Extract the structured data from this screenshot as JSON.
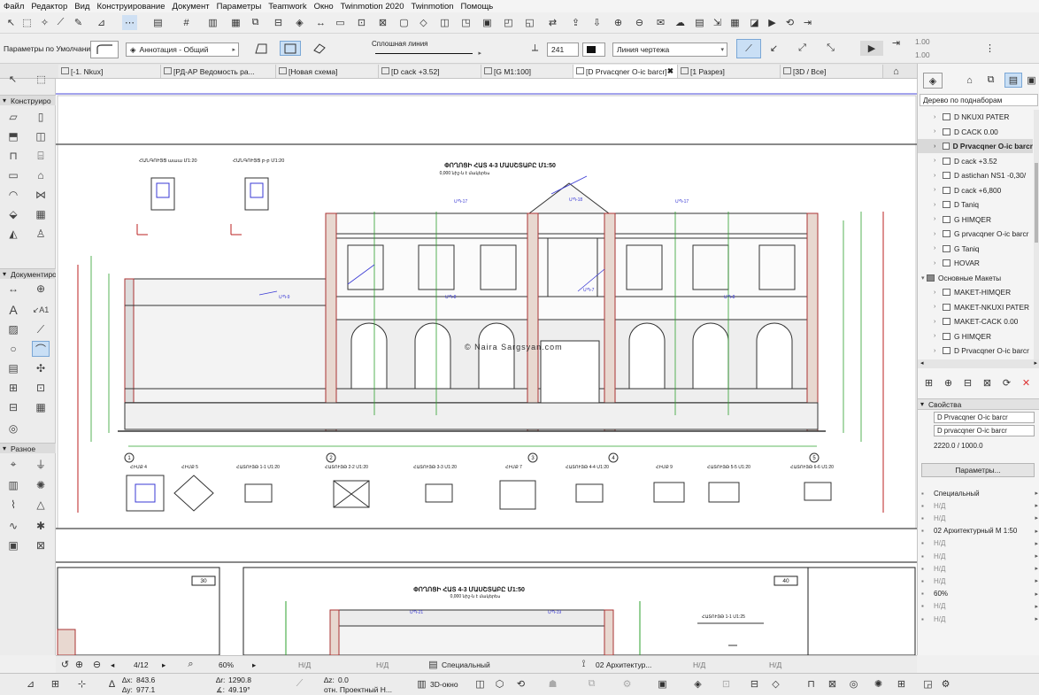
{
  "menu": [
    "Файл",
    "Редактор",
    "Вид",
    "Конструирование",
    "Документ",
    "Параметры",
    "Teamwork",
    "Окно",
    "Twinmotion 2020",
    "Twinmotion",
    "Помощь"
  ],
  "infobox": {
    "favorites_label": "Параметры по Умолчанию",
    "layer_value": "Аннотация - Общий",
    "line_type": "Сплошная линия",
    "pen_number": "241",
    "line_category": "Линия чертежа",
    "scale_a": "1.00",
    "scale_b": "1.00"
  },
  "tabs": [
    "[-1. Nkux]",
    "[РД-АР Ведомость ра...",
    "[Новая схема]",
    "[D cack +3.52]",
    "[G M1:100]",
    "[D Prvacqner O-ic barcr]",
    "[1 Разрез]",
    "[3D / Все]"
  ],
  "toolbox": {
    "section_design": "Конструиро",
    "section_document": "Документиро",
    "section_misc": "Разное"
  },
  "navigator": {
    "header": "Дерево по подн­аборам",
    "items": [
      {
        "label": "D NKUXI PATER",
        "indent": 1,
        "selected": false
      },
      {
        "label": "D CACK 0.00",
        "indent": 1,
        "selected": false
      },
      {
        "label": "D Prvacqner O-ic barcr",
        "indent": 1,
        "selected": true
      },
      {
        "label": "D cack +3.52",
        "indent": 1,
        "selected": false
      },
      {
        "label": "D astichan NS1 -0,30/",
        "indent": 1,
        "selected": false
      },
      {
        "label": "D cack +6,800",
        "indent": 1,
        "selected": false
      },
      {
        "label": "D Taniq",
        "indent": 1,
        "selected": false
      },
      {
        "label": "G HIMQER",
        "indent": 1,
        "selected": false
      },
      {
        "label": "G prvacqner O-ic barcr",
        "indent": 1,
        "selected": false
      },
      {
        "label": "G Taniq",
        "indent": 1,
        "selected": false
      },
      {
        "label": "HOVAR",
        "indent": 1,
        "selected": false
      },
      {
        "label": "Основные Макеты",
        "indent": 0,
        "selected": false
      },
      {
        "label": "MAKET-HIMQER",
        "indent": 1,
        "selected": false
      },
      {
        "label": "MAKET-NKUXI PATER",
        "indent": 1,
        "selected": false
      },
      {
        "label": "MAKET-CACK 0.00",
        "indent": 1,
        "selected": false
      },
      {
        "label": "G HIMQER",
        "indent": 1,
        "selected": false
      },
      {
        "label": "D Prvacqner O-ic barcr",
        "indent": 1,
        "selected": false
      }
    ]
  },
  "properties": {
    "header": "Свойства",
    "name_value": "D Prvacqner O-ic barcr",
    "id_value": "D prvacqner O-ic barcr",
    "size_value": "2220.0 / 1000.0",
    "params_button": "Параметры...",
    "rows": [
      "Специальный",
      "Н/Д",
      "Н/Д",
      "02 Архитектурный М 1:50",
      "Н/Д",
      "Н/Д",
      "Н/Д",
      "Н/Д",
      "60%",
      "Н/Д",
      "Н/Д"
    ]
  },
  "status": {
    "page": "4/12",
    "zoom": "60%",
    "nd1": "Н/Д",
    "nd2": "Н/Д",
    "special": "Специальный",
    "arch": "02 Архитектур...",
    "nd3": "Н/Д",
    "nd4": "Н/Д"
  },
  "coords": {
    "dx": "843.6",
    "dy": "977.1",
    "dr": "1290.8",
    "angle": "49.19°",
    "dz": "0.0",
    "ref": "отн. Проектный Н...",
    "view3d": "3D-окно"
  },
  "drawing": {
    "main_title": "ՓՈՂՈՑԻ ՀԱՏ 4-3 ՄԱՍՇՏԱԲԸ Մ1:50",
    "main_sub": "0,000 նիշ-ն է մակերես",
    "node_a": "ՀԱՆԳՈՒՅՑ աաա Մ1:20",
    "node_b": "ՀԱՆԳՈՒՅՑ բ-բ Մ1:20",
    "watermark": "© Naira Sargsyan.com",
    "lower_title": "ՓՈՂՈՑԻ ՀԱՏ 4-3 ՄԱՍՇՏԱԲԸ Մ1:50",
    "lower_sub": "0,000 նիշ-ն է մակերես",
    "sheet_30": "30",
    "sheet_40": "40",
    "sec_11": "ՀԱՏՈՒՅԹ 1-1 Մ1:20",
    "sec_22": "ՀԱՏՈՒՅԹ 2-2 Մ1:20",
    "sec_33": "ՀԱՏՈՒՅԹ 3-3 Մ1:20",
    "sec_44": "ՀԱՏՈՒՅԹ 4-4 Մ1:20",
    "sec_55": "ՀԱՏՈՒՅԹ 5-5 Մ1:20",
    "sec_66": "ՀԱՏՈՒՅԹ 6-6 Մ1:20",
    "sec_1125": "ՀԱՏՈՒՅԹ 1-1 Մ1:25",
    "node_4": "ՀԻՄՔ 4",
    "node_5": "ՀԻՄՔ 5",
    "node_7": "ՀԻՄՔ 7",
    "node_9": "ՀԻՄՔ 9",
    "axes": [
      "1",
      "2",
      "3",
      "4",
      "5"
    ],
    "tags": [
      "ՄՊ-17",
      "ՄՊ-18",
      "ՄՊ-17",
      "ՄՊ-9",
      "ՄՊ-8",
      "ՄՊ-7",
      "ՄՊ-8",
      "ՄՊ-21",
      "ՄՊ-19"
    ]
  }
}
